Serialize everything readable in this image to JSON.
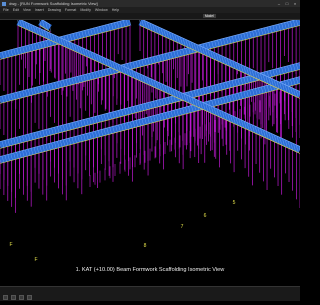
{
  "window": {
    "title": "dwg - [RUN Formwork Scaffolding Isometric View]"
  },
  "menubar": {
    "items": [
      "File",
      "Edit",
      "View",
      "Insert",
      "Drawing",
      "Format",
      "Modify",
      "Window",
      "Help"
    ]
  },
  "toolbar": {
    "view_tab": "Model"
  },
  "viewport": {
    "grid_labels": [
      "5",
      "6",
      "7",
      "8",
      "F",
      "F"
    ],
    "caption": "1. KAT (+10.00) Beam Formwork Scaffolding Isometric View"
  },
  "colors": {
    "background": "#000000",
    "beam_blue": "#2d6fd6",
    "beam_edge": "#7fb0ff",
    "beam_highlight": "#e6d84a",
    "prop_magenta": "#c21ad6",
    "grid_label_yellow": "#e5e24a"
  }
}
